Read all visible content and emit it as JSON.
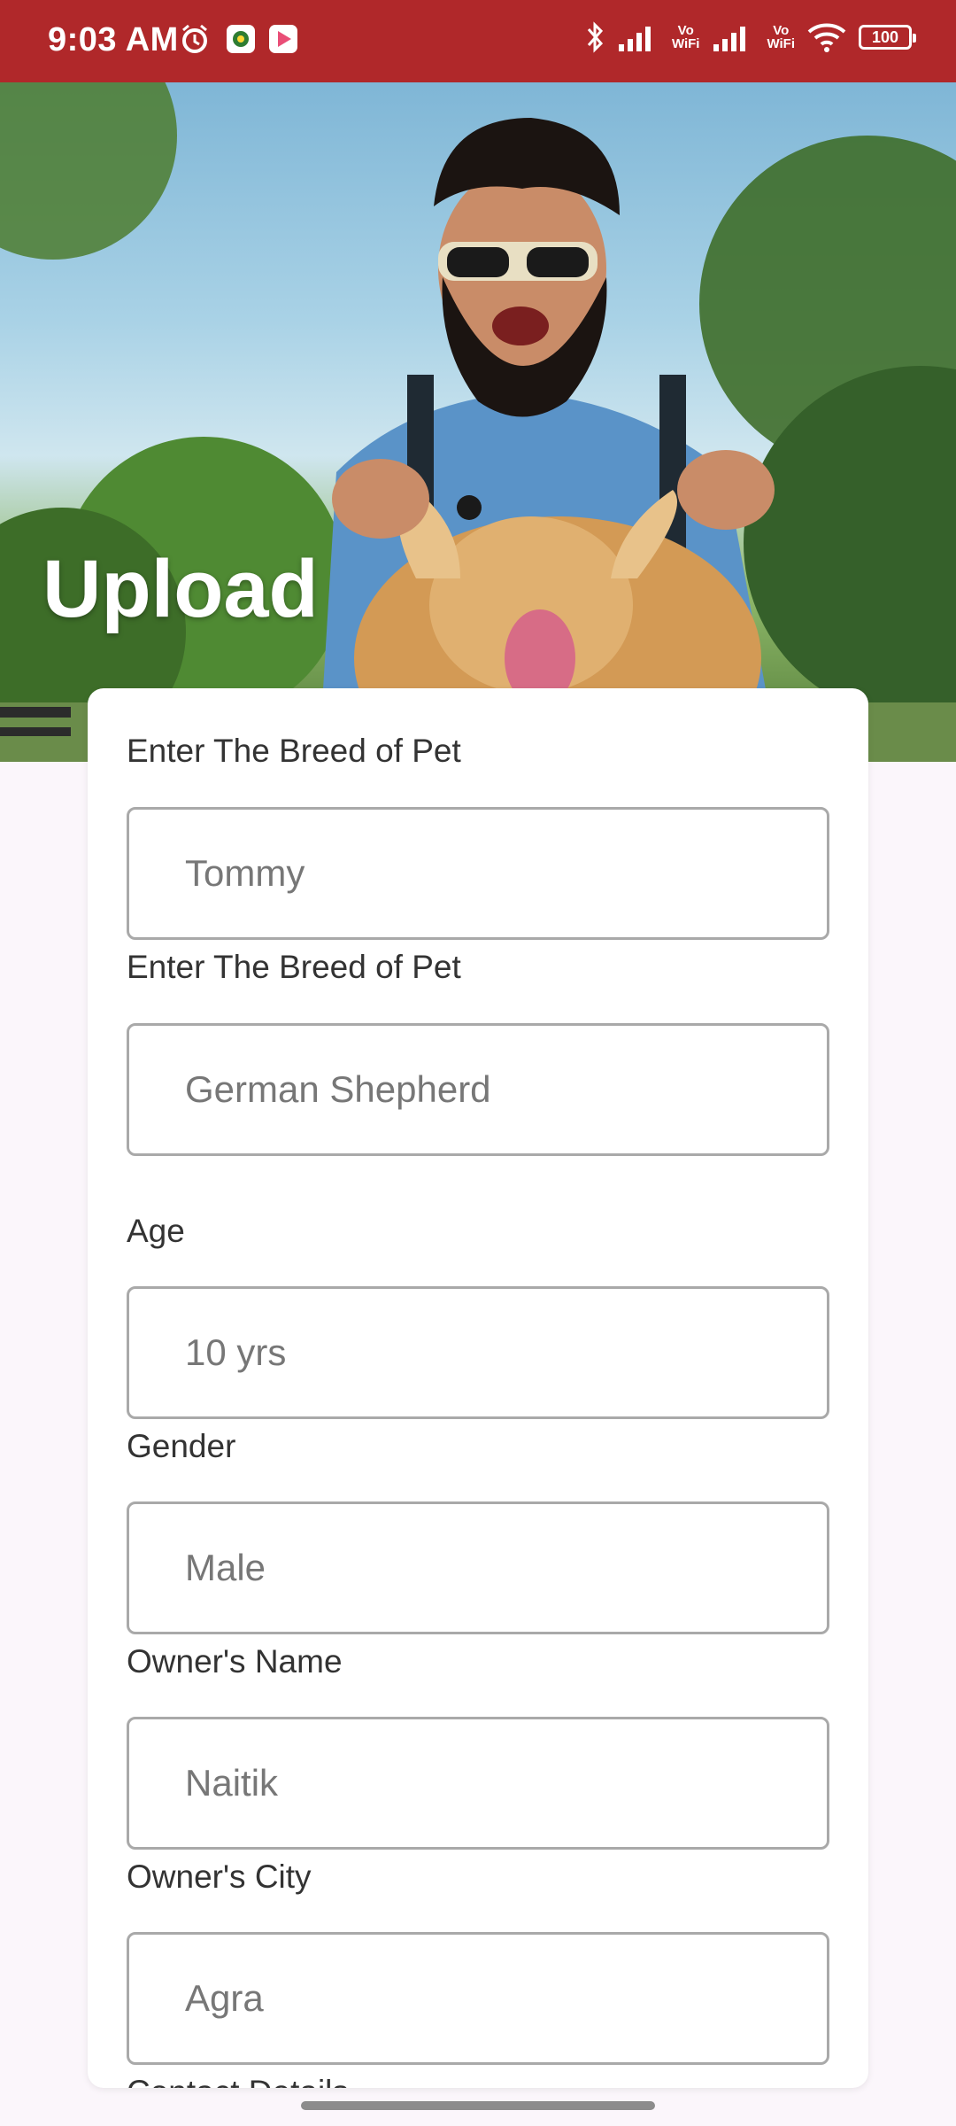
{
  "status_bar": {
    "time": "9:03 AM",
    "vowifi_1": "Vo\nWiFi",
    "vowifi_2": "Vo\nWiFi",
    "battery": "100"
  },
  "hero": {
    "title": "Upload"
  },
  "form": {
    "fields": [
      {
        "label": "Enter The Breed of Pet",
        "placeholder": "Tommy"
      },
      {
        "label": "Enter The Breed of Pet",
        "placeholder": "German Shepherd"
      },
      {
        "label": "Age",
        "placeholder": "10 yrs"
      },
      {
        "label": "Gender",
        "placeholder": "Male"
      },
      {
        "label": "Owner's Name",
        "placeholder": "Naitik"
      },
      {
        "label": "Owner's City",
        "placeholder": "Agra"
      }
    ],
    "next_label_partial": "Contact Details"
  }
}
